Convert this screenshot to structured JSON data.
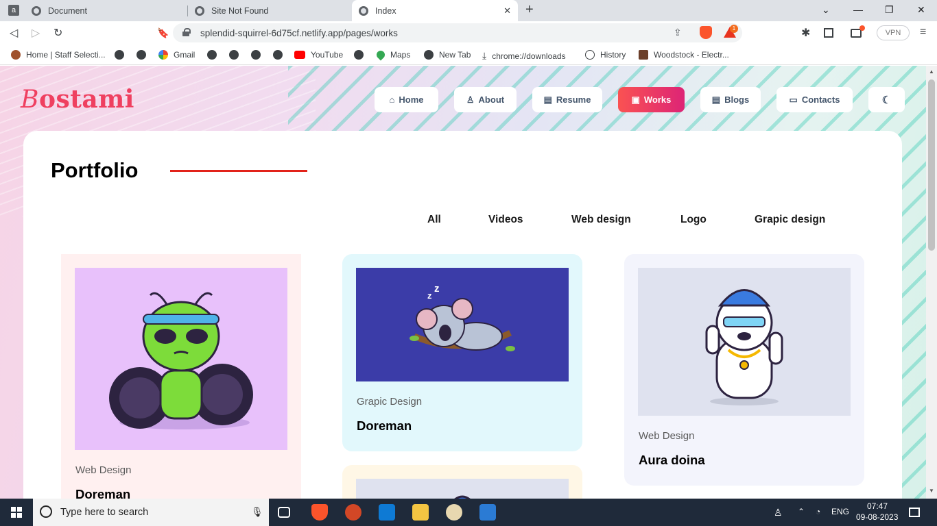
{
  "browser": {
    "tabs": [
      {
        "title": "Document"
      },
      {
        "title": "Site Not Found"
      },
      {
        "title": "Index"
      }
    ],
    "new_tab": "+",
    "url": "splendid-squirrel-6d75cf.netlify.app/pages/works",
    "vpn": "VPN",
    "shield_badge": "1",
    "bookmarks": [
      "Home | Staff Selecti...",
      "Gmail",
      "YouTube",
      "Maps",
      "New Tab",
      "chrome://downloads",
      "History",
      "Woodstock - Electr..."
    ]
  },
  "site": {
    "logo_initial": "B",
    "logo_rest": "ostami",
    "nav": [
      "Home",
      "About",
      "Resume",
      "Works",
      "Blogs",
      "Contacts"
    ],
    "active_nav": "Works",
    "accent": "#ef4060",
    "active_gradient": [
      "#fa5252",
      "#dd2476"
    ]
  },
  "portfolio": {
    "title": "Portfolio",
    "filters": [
      "All",
      "Videos",
      "Web design",
      "Logo",
      "Grapic design"
    ],
    "items": [
      {
        "category": "Web Design",
        "name": "Doreman",
        "card_bg": "#fff0f0",
        "thumb_bg": "#e8c1fb"
      },
      {
        "category": "Grapic Design",
        "name": "Doreman",
        "card_bg": "#e2f8fc",
        "thumb_bg": "#3b3ca8"
      },
      {
        "category": "Web Design",
        "name": "Aura doina",
        "card_bg": "#f3f4fc",
        "thumb_bg": "#dfe2ef"
      }
    ]
  },
  "taskbar": {
    "search_placeholder": "Type here to search",
    "lang": "ENG",
    "time": "07:47",
    "date": "09-08-2023"
  }
}
